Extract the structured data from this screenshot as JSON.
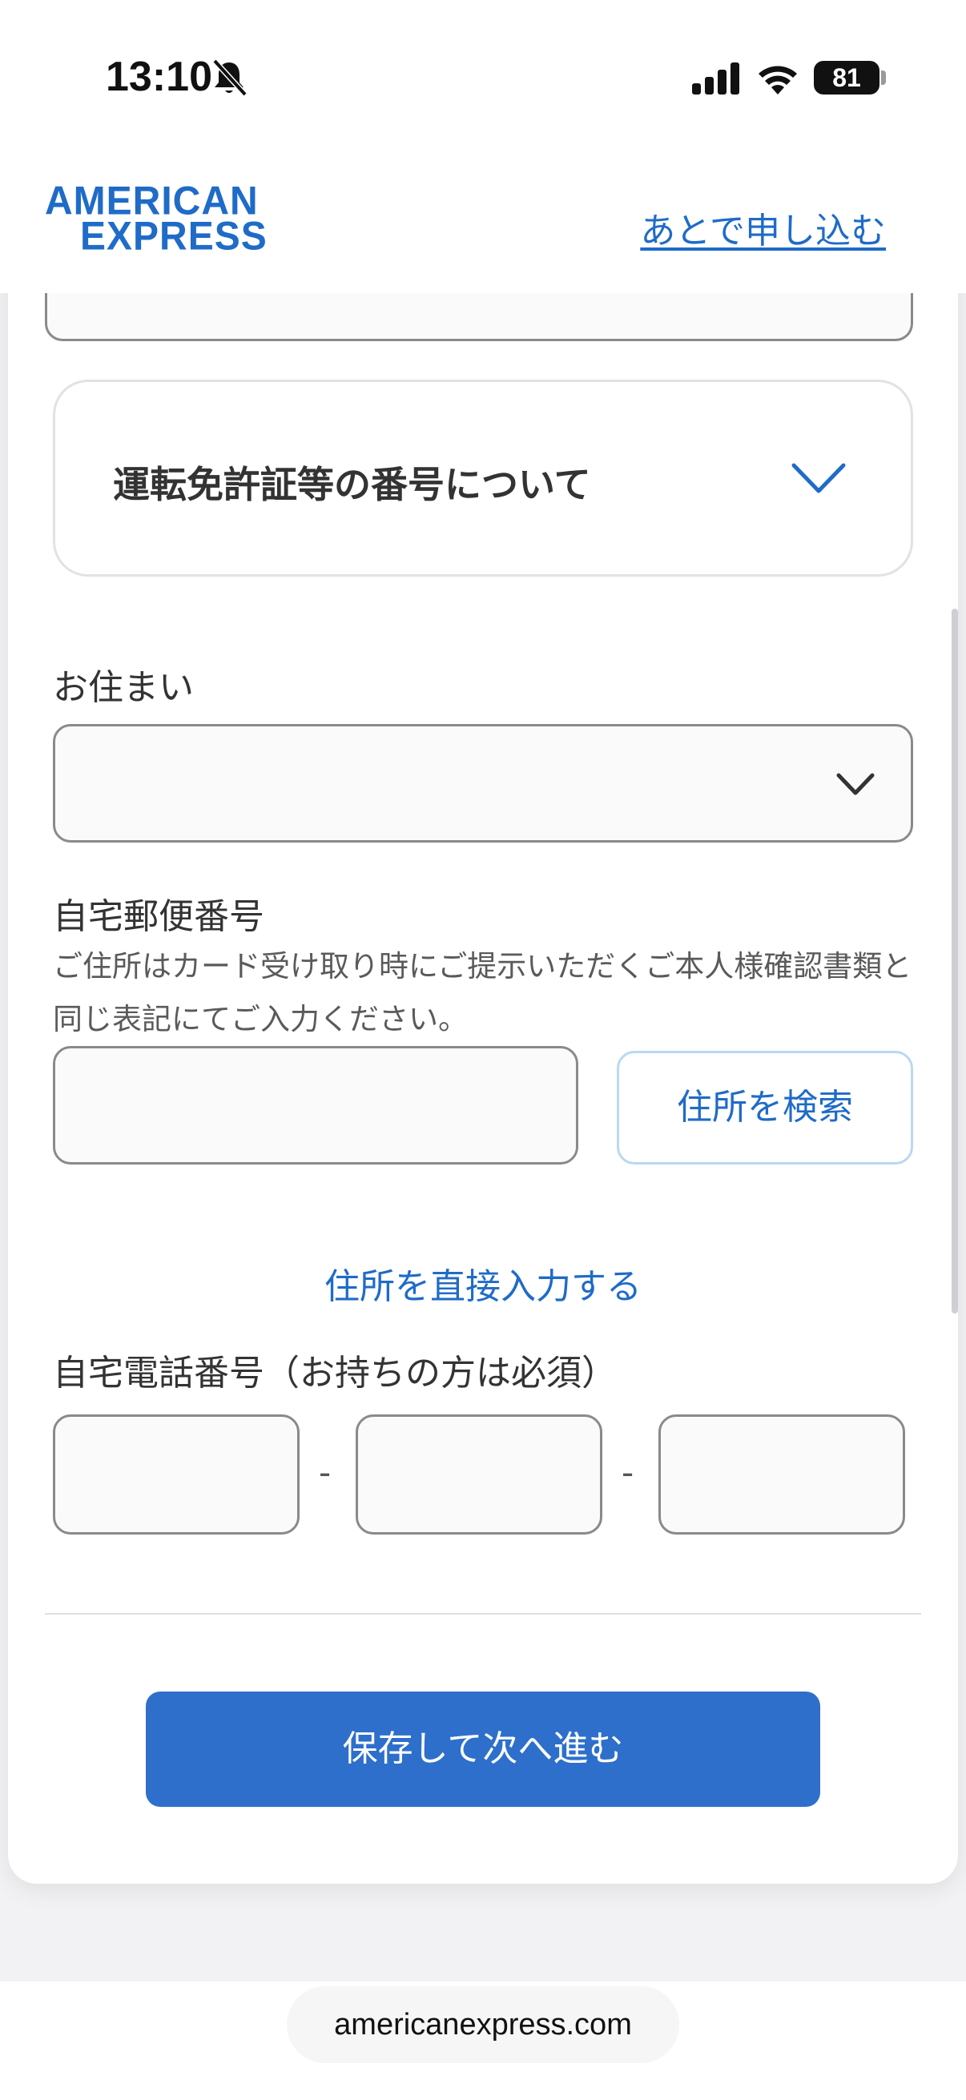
{
  "status_bar": {
    "time": "13:10",
    "battery": "81",
    "icons": [
      "bell-slash-icon",
      "signal-icon",
      "wifi-icon",
      "battery-icon"
    ]
  },
  "header": {
    "logo_line1": "AMERICAN",
    "logo_line2": "EXPRESS",
    "apply_later": "あとで申し込む",
    "brand_color": "#1f6bc8"
  },
  "form": {
    "accordion_title": "運転免許証等の番号について",
    "residence_label": "お住まい",
    "residence_value": "",
    "postal_label": "自宅郵便番号",
    "postal_help": "ご住所はカード受け取り時にご提示いただくご本人様確認書類と同じ表記にてご入力ください。",
    "postal_value": "",
    "search_button": "住所を検索",
    "direct_input_link": "住所を直接入力する",
    "phone_label": "自宅電話番号（お持ちの方は必須）",
    "phone_parts": [
      "",
      "",
      ""
    ],
    "phone_separator": "-",
    "save_button": "保存して次へ進む",
    "button_color": "#2e6fcb"
  },
  "browser": {
    "url": "americanexpress.com"
  }
}
